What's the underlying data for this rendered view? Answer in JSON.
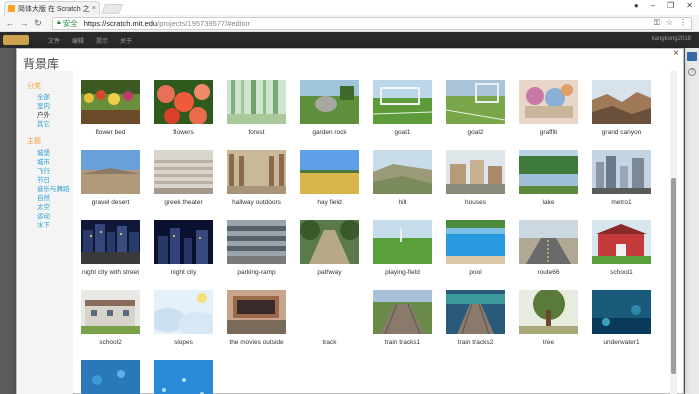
{
  "browser": {
    "tab_title": "简体大版 在 Scratch 之",
    "address_secure_label": "安全",
    "url_host": "https://scratch.mit.edu",
    "url_path": "/projects/195739577/#editor"
  },
  "editor": {
    "menu_items": [
      "文件",
      "编辑",
      "提示",
      "关于"
    ],
    "username": "kangkong2018"
  },
  "modal": {
    "title": "背景库",
    "close_glyph": "×",
    "categories": {
      "theme_title": "分类",
      "theme_items": [
        "全部",
        "室内",
        "户外",
        "其它"
      ],
      "topic_title": "主题",
      "topic_items": [
        "城堡",
        "城市",
        "飞行",
        "节日",
        "音乐与舞蹈",
        "自然",
        "太空",
        "运动",
        "水下"
      ]
    },
    "selected_category": "户外",
    "backdrops": [
      {
        "name": "flower bed",
        "art": "flowerbed"
      },
      {
        "name": "flowers",
        "art": "flowers"
      },
      {
        "name": "forest",
        "art": "forest"
      },
      {
        "name": "garden rock",
        "art": "gardenrock"
      },
      {
        "name": "goal1",
        "art": "goal1"
      },
      {
        "name": "goal2",
        "art": "goal2"
      },
      {
        "name": "graffiti",
        "art": "graffiti"
      },
      {
        "name": "grand canyon",
        "art": "canyon"
      },
      {
        "name": "gravel desert",
        "art": "desert"
      },
      {
        "name": "greek theater",
        "art": "theater"
      },
      {
        "name": "hallway outdoors",
        "art": "hallway"
      },
      {
        "name": "hay field",
        "art": "hayfield"
      },
      {
        "name": "hill",
        "art": "hill"
      },
      {
        "name": "houses",
        "art": "houses"
      },
      {
        "name": "lake",
        "art": "lake"
      },
      {
        "name": "metro1",
        "art": "metro"
      },
      {
        "name": "night city with street",
        "art": "nightstreet"
      },
      {
        "name": "night city",
        "art": "nightcity"
      },
      {
        "name": "parking-ramp",
        "art": "parking"
      },
      {
        "name": "pathway",
        "art": "pathway"
      },
      {
        "name": "playing-field",
        "art": "field"
      },
      {
        "name": "pool",
        "art": "pool"
      },
      {
        "name": "route66",
        "art": "route"
      },
      {
        "name": "school1",
        "art": "school1"
      },
      {
        "name": "school2",
        "art": "school2"
      },
      {
        "name": "slopes",
        "art": "slopes"
      },
      {
        "name": "the movies outside",
        "art": "movies"
      },
      {
        "name": "track",
        "art": "none"
      },
      {
        "name": "train tracks1",
        "art": "train1"
      },
      {
        "name": "train tracks2",
        "art": "train2"
      },
      {
        "name": "tree",
        "art": "tree"
      },
      {
        "name": "underwater1",
        "art": "underwater1"
      },
      {
        "name": "",
        "art": "underwater2"
      },
      {
        "name": "",
        "art": "underwater3"
      }
    ]
  }
}
